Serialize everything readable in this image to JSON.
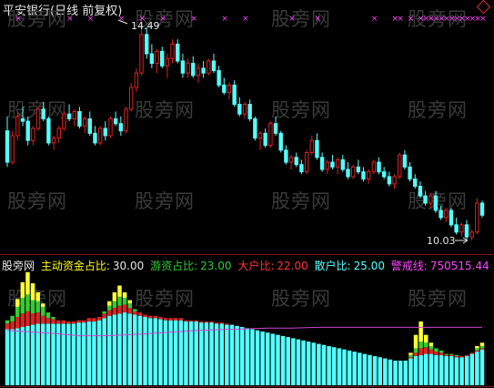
{
  "stock_title": "平安银行(日线 前复权)",
  "watermark_text": "股旁网",
  "price_annotations": {
    "high": "14.49",
    "low": "10.03"
  },
  "indicator_legend": {
    "name": "股旁网",
    "items": [
      {
        "label": "主动资金占比:",
        "value": "30.00",
        "color": "#ffff00"
      },
      {
        "label": "游资占比:",
        "value": "23.00",
        "color": "#33cc33"
      },
      {
        "label": "大户比:",
        "value": "22.00",
        "color": "#ff3333"
      },
      {
        "label": "散户比:",
        "value": "25.00",
        "color": "#55ffff"
      },
      {
        "label": "警戒线:",
        "value": "750515.44",
        "color": "#ff44ff"
      }
    ]
  },
  "colors": {
    "up": "#e02020",
    "down": "#55ffff",
    "markers": "#ff44ff",
    "retail": "#55ffff",
    "big": "#dd2222",
    "hot": "#33cc33",
    "main": "#ffff33",
    "alert": "#cc44cc"
  },
  "candles": [
    [
      12.3,
      12.6,
      11.55,
      11.65
    ],
    [
      11.65,
      12.3,
      11.6,
      12.2
    ],
    [
      12.2,
      12.7,
      12.1,
      12.6
    ],
    [
      12.55,
      12.8,
      12.4,
      12.5
    ],
    [
      12.5,
      12.6,
      12.0,
      12.1
    ],
    [
      12.1,
      12.4,
      12.0,
      12.35
    ],
    [
      12.35,
      12.8,
      12.3,
      12.75
    ],
    [
      12.75,
      12.9,
      12.5,
      12.55
    ],
    [
      12.55,
      12.6,
      12.0,
      12.05
    ],
    [
      12.05,
      12.2,
      11.9,
      12.15
    ],
    [
      12.15,
      12.4,
      12.05,
      12.35
    ],
    [
      12.35,
      12.7,
      12.3,
      12.65
    ],
    [
      12.65,
      12.85,
      12.5,
      12.55
    ],
    [
      12.55,
      12.75,
      12.4,
      12.7
    ],
    [
      12.7,
      12.8,
      12.35,
      12.4
    ],
    [
      12.4,
      12.6,
      12.25,
      12.55
    ],
    [
      12.55,
      12.7,
      12.2,
      12.25
    ],
    [
      12.25,
      12.4,
      12.0,
      12.05
    ],
    [
      12.05,
      12.4,
      12.0,
      12.35
    ],
    [
      12.35,
      12.5,
      12.1,
      12.2
    ],
    [
      12.2,
      12.6,
      12.15,
      12.55
    ],
    [
      12.55,
      12.7,
      12.4,
      12.45
    ],
    [
      12.45,
      12.6,
      12.2,
      12.3
    ],
    [
      12.3,
      12.8,
      12.25,
      12.75
    ],
    [
      12.75,
      13.3,
      12.7,
      13.2
    ],
    [
      13.2,
      13.6,
      13.1,
      13.5
    ],
    [
      13.5,
      14.49,
      13.45,
      14.3
    ],
    [
      14.3,
      14.45,
      13.8,
      13.9
    ],
    [
      13.9,
      14.1,
      13.6,
      13.7
    ],
    [
      13.7,
      14.0,
      13.5,
      13.95
    ],
    [
      13.95,
      14.05,
      13.6,
      13.65
    ],
    [
      13.65,
      13.9,
      13.4,
      13.8
    ],
    [
      13.8,
      14.2,
      13.7,
      14.1
    ],
    [
      14.1,
      14.2,
      13.7,
      13.75
    ],
    [
      13.75,
      13.9,
      13.4,
      13.5
    ],
    [
      13.5,
      13.8,
      13.4,
      13.7
    ],
    [
      13.7,
      13.85,
      13.4,
      13.45
    ],
    [
      13.45,
      13.7,
      13.3,
      13.6
    ],
    [
      13.6,
      13.75,
      13.4,
      13.5
    ],
    [
      13.5,
      13.8,
      13.45,
      13.75
    ],
    [
      13.75,
      13.9,
      13.5,
      13.55
    ],
    [
      13.55,
      13.65,
      13.2,
      13.25
    ],
    [
      13.25,
      13.4,
      13.05,
      13.1
    ],
    [
      13.1,
      13.3,
      12.95,
      13.25
    ],
    [
      13.25,
      13.35,
      12.8,
      12.85
    ],
    [
      12.85,
      13.0,
      12.6,
      12.65
    ],
    [
      12.65,
      12.9,
      12.55,
      12.85
    ],
    [
      12.85,
      12.95,
      12.5,
      12.55
    ],
    [
      12.55,
      12.6,
      12.1,
      12.15
    ],
    [
      12.15,
      12.3,
      11.9,
      12.25
    ],
    [
      12.25,
      12.35,
      11.95,
      12.0
    ],
    [
      12.0,
      12.5,
      11.95,
      12.45
    ],
    [
      12.45,
      12.6,
      12.2,
      12.25
    ],
    [
      12.25,
      12.3,
      11.85,
      11.9
    ],
    [
      11.9,
      12.0,
      11.6,
      11.65
    ],
    [
      11.65,
      11.8,
      11.5,
      11.75
    ],
    [
      11.75,
      11.85,
      11.55,
      11.6
    ],
    [
      11.6,
      11.7,
      11.4,
      11.45
    ],
    [
      11.45,
      11.9,
      11.4,
      11.85
    ],
    [
      11.85,
      12.2,
      11.8,
      12.1
    ],
    [
      12.1,
      12.25,
      11.7,
      11.75
    ],
    [
      11.75,
      11.85,
      11.45,
      11.5
    ],
    [
      11.5,
      11.7,
      11.4,
      11.65
    ],
    [
      11.65,
      11.8,
      11.5,
      11.55
    ],
    [
      11.55,
      11.75,
      11.4,
      11.7
    ],
    [
      11.7,
      11.8,
      11.45,
      11.5
    ],
    [
      11.5,
      11.65,
      11.3,
      11.35
    ],
    [
      11.35,
      11.6,
      11.3,
      11.55
    ],
    [
      11.55,
      11.7,
      11.4,
      11.45
    ],
    [
      11.45,
      11.55,
      11.25,
      11.3
    ],
    [
      11.3,
      11.5,
      11.2,
      11.45
    ],
    [
      11.45,
      11.7,
      11.4,
      11.65
    ],
    [
      11.65,
      11.75,
      11.4,
      11.45
    ],
    [
      11.45,
      11.55,
      11.3,
      11.35
    ],
    [
      11.35,
      11.45,
      11.15,
      11.2
    ],
    [
      11.2,
      11.4,
      11.1,
      11.35
    ],
    [
      11.35,
      11.85,
      11.3,
      11.8
    ],
    [
      11.8,
      11.9,
      11.5,
      11.55
    ],
    [
      11.55,
      11.65,
      11.25,
      11.3
    ],
    [
      11.3,
      11.4,
      11.1,
      11.15
    ],
    [
      11.15,
      11.25,
      10.9,
      10.95
    ],
    [
      10.95,
      11.05,
      10.75,
      10.8
    ],
    [
      10.8,
      11.0,
      10.7,
      10.95
    ],
    [
      10.95,
      11.05,
      10.6,
      10.65
    ],
    [
      10.65,
      10.75,
      10.45,
      10.5
    ],
    [
      10.5,
      10.7,
      10.4,
      10.65
    ],
    [
      10.65,
      10.7,
      10.3,
      10.35
    ],
    [
      10.35,
      10.5,
      10.15,
      10.2
    ],
    [
      10.2,
      10.4,
      10.1,
      10.35
    ],
    [
      10.35,
      10.45,
      10.05,
      10.1
    ],
    [
      10.1,
      10.25,
      10.03,
      10.2
    ],
    [
      10.2,
      10.9,
      10.15,
      10.8
    ],
    [
      10.8,
      10.85,
      10.5,
      10.55
    ]
  ],
  "marker_positions": [
    2,
    12,
    16,
    22,
    26,
    30,
    36,
    42,
    46,
    55,
    60,
    71,
    75,
    76,
    78,
    80,
    81,
    82,
    83,
    84,
    85,
    86,
    87,
    88,
    89,
    90,
    91,
    92
  ],
  "indicator_bars": [
    [
      0.5,
      0.05,
      0.03,
      0.0
    ],
    [
      0.5,
      0.07,
      0.05,
      0.0
    ],
    [
      0.51,
      0.1,
      0.09,
      0.07
    ],
    [
      0.52,
      0.12,
      0.14,
      0.14
    ],
    [
      0.53,
      0.13,
      0.15,
      0.2
    ],
    [
      0.54,
      0.1,
      0.12,
      0.15
    ],
    [
      0.55,
      0.1,
      0.1,
      0.08
    ],
    [
      0.55,
      0.07,
      0.08,
      0.03
    ],
    [
      0.55,
      0.05,
      0.05,
      0.0
    ],
    [
      0.55,
      0.04,
      0.02,
      0.0
    ],
    [
      0.55,
      0.03,
      0.0,
      0.0
    ],
    [
      0.55,
      0.03,
      0.0,
      0.0
    ],
    [
      0.55,
      0.02,
      0.0,
      0.0
    ],
    [
      0.55,
      0.02,
      0.0,
      0.0
    ],
    [
      0.56,
      0.02,
      0.0,
      0.0
    ],
    [
      0.56,
      0.02,
      0.0,
      0.0
    ],
    [
      0.57,
      0.03,
      0.0,
      0.0
    ],
    [
      0.57,
      0.03,
      0.0,
      0.0
    ],
    [
      0.58,
      0.03,
      0.0,
      0.0
    ],
    [
      0.6,
      0.04,
      0.02,
      0.0
    ],
    [
      0.62,
      0.05,
      0.04,
      0.04
    ],
    [
      0.63,
      0.06,
      0.06,
      0.08
    ],
    [
      0.64,
      0.07,
      0.08,
      0.1
    ],
    [
      0.65,
      0.07,
      0.06,
      0.05
    ],
    [
      0.64,
      0.05,
      0.04,
      0.03
    ],
    [
      0.63,
      0.03,
      0.02,
      0.0
    ],
    [
      0.62,
      0.03,
      0.0,
      0.0
    ],
    [
      0.61,
      0.02,
      0.0,
      0.0
    ],
    [
      0.6,
      0.02,
      0.0,
      0.0
    ],
    [
      0.6,
      0.02,
      0.0,
      0.0
    ],
    [
      0.59,
      0.02,
      0.0,
      0.0
    ],
    [
      0.58,
      0.02,
      0.0,
      0.0
    ],
    [
      0.58,
      0.02,
      0.0,
      0.0
    ],
    [
      0.58,
      0.02,
      0.0,
      0.0
    ],
    [
      0.58,
      0.02,
      0.0,
      0.0
    ],
    [
      0.57,
      0.01,
      0.0,
      0.0
    ],
    [
      0.57,
      0.01,
      0.0,
      0.0
    ],
    [
      0.57,
      0.01,
      0.0,
      0.0
    ],
    [
      0.56,
      0.01,
      0.0,
      0.0
    ],
    [
      0.56,
      0.01,
      0.0,
      0.0
    ],
    [
      0.56,
      0.01,
      0.0,
      0.0
    ],
    [
      0.55,
      0.01,
      0.0,
      0.0
    ],
    [
      0.55,
      0.01,
      0.0,
      0.0
    ],
    [
      0.54,
      0.01,
      0.0,
      0.0
    ],
    [
      0.54,
      0.0,
      0.0,
      0.0
    ],
    [
      0.53,
      0.0,
      0.0,
      0.0
    ],
    [
      0.52,
      0.0,
      0.0,
      0.0
    ],
    [
      0.51,
      0.0,
      0.0,
      0.0
    ],
    [
      0.5,
      0.0,
      0.0,
      0.0
    ],
    [
      0.49,
      0.0,
      0.0,
      0.0
    ],
    [
      0.48,
      0.0,
      0.0,
      0.0
    ],
    [
      0.47,
      0.0,
      0.0,
      0.0
    ],
    [
      0.46,
      0.0,
      0.0,
      0.0
    ],
    [
      0.45,
      0.0,
      0.0,
      0.0
    ],
    [
      0.44,
      0.0,
      0.0,
      0.0
    ],
    [
      0.43,
      0.0,
      0.0,
      0.0
    ],
    [
      0.42,
      0.0,
      0.0,
      0.0
    ],
    [
      0.41,
      0.0,
      0.0,
      0.0
    ],
    [
      0.4,
      0.0,
      0.0,
      0.0
    ],
    [
      0.39,
      0.0,
      0.0,
      0.0
    ],
    [
      0.38,
      0.0,
      0.0,
      0.0
    ],
    [
      0.37,
      0.0,
      0.0,
      0.0
    ],
    [
      0.36,
      0.0,
      0.0,
      0.0
    ],
    [
      0.35,
      0.0,
      0.0,
      0.0
    ],
    [
      0.34,
      0.0,
      0.0,
      0.0
    ],
    [
      0.33,
      0.0,
      0.0,
      0.0
    ],
    [
      0.32,
      0.0,
      0.0,
      0.0
    ],
    [
      0.31,
      0.0,
      0.0,
      0.0
    ],
    [
      0.3,
      0.0,
      0.0,
      0.0
    ],
    [
      0.29,
      0.0,
      0.0,
      0.0
    ],
    [
      0.28,
      0.0,
      0.0,
      0.0
    ],
    [
      0.27,
      0.0,
      0.0,
      0.0
    ],
    [
      0.26,
      0.0,
      0.0,
      0.0
    ],
    [
      0.25,
      0.0,
      0.0,
      0.0
    ],
    [
      0.24,
      0.0,
      0.0,
      0.0
    ],
    [
      0.23,
      0.0,
      0.0,
      0.0
    ],
    [
      0.22,
      0.0,
      0.0,
      0.0
    ],
    [
      0.22,
      0.0,
      0.0,
      0.0
    ],
    [
      0.22,
      0.0,
      0.0,
      0.0
    ],
    [
      0.24,
      0.01,
      0.02,
      0.02
    ],
    [
      0.26,
      0.03,
      0.04,
      0.12
    ],
    [
      0.27,
      0.06,
      0.06,
      0.18
    ],
    [
      0.28,
      0.06,
      0.04,
      0.07
    ],
    [
      0.28,
      0.04,
      0.03,
      0.03
    ],
    [
      0.27,
      0.03,
      0.03,
      0.0
    ],
    [
      0.27,
      0.02,
      0.02,
      0.0
    ],
    [
      0.26,
      0.01,
      0.01,
      0.0
    ],
    [
      0.26,
      0.01,
      0.01,
      0.0
    ],
    [
      0.25,
      0.01,
      0.01,
      0.0
    ],
    [
      0.25,
      0.01,
      0.0,
      0.0
    ],
    [
      0.26,
      0.01,
      0.0,
      0.0
    ],
    [
      0.28,
      0.01,
      0.0,
      0.0
    ],
    [
      0.3,
      0.01,
      0.02,
      0.02
    ],
    [
      0.32,
      0.01,
      0.02,
      0.03
    ]
  ],
  "alert_line": [
    0.72,
    0.7,
    0.68,
    0.65,
    0.65,
    0.66,
    0.68,
    0.7,
    0.72,
    0.73,
    0.74,
    0.75,
    0.75,
    0.76,
    0.76,
    0.76,
    0.76,
    0.76,
    0.76,
    0.76,
    0.76
  ]
}
